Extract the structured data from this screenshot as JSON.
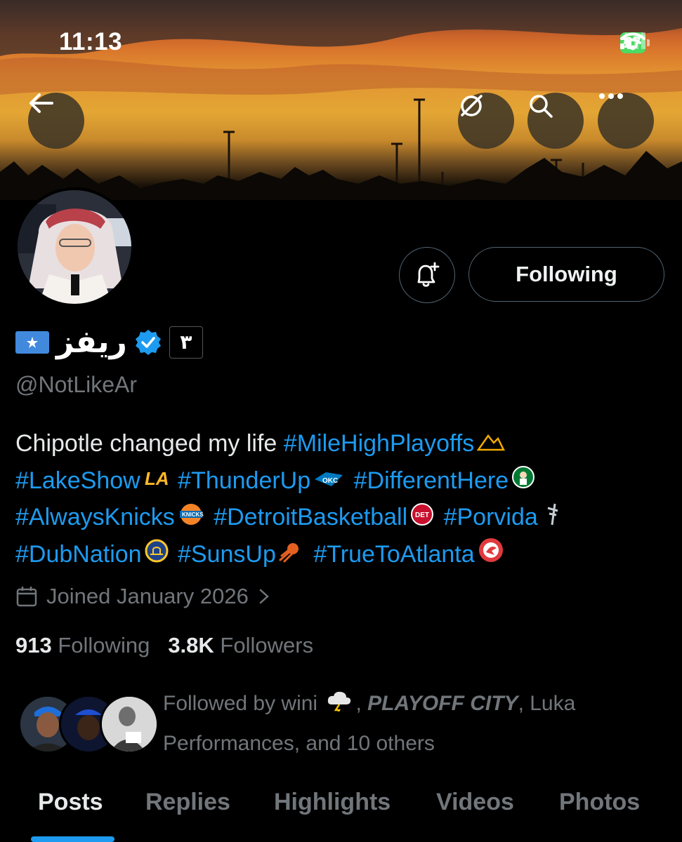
{
  "status_bar": {
    "time": "11:13",
    "battery": "27"
  },
  "header": {
    "back_icon": "arrow-left-icon",
    "grok_icon": "grok-icon",
    "search_icon": "search-icon",
    "more_icon": "more-icon"
  },
  "profile": {
    "display_name": "ريفز",
    "badge_text": "٣",
    "handle": "@NotLikeAr",
    "follow_button": "Following",
    "bio": {
      "text": "Chipotle changed my life",
      "tags": [
        "#MileHighPlayoffs",
        "#LakeShow",
        "#ThunderUp",
        "#DifferentHere",
        "#AlwaysKnicks",
        "#DetroitBasketball",
        "#Porvida",
        "#DubNation",
        "#SunsUp",
        "#TrueToAtlanta"
      ]
    },
    "joined": "Joined January 2026",
    "following_count": "913",
    "following_label": "Following",
    "followers_count": "3.8K",
    "followers_label": "Followers",
    "followed_by": {
      "prefix": "Followed by wini",
      "sep": ",",
      "bold": "PLAYOFF CITY",
      "rest": ", Luka Performances, and 10 others"
    }
  },
  "colors": {
    "accent": "#1d9bf0",
    "muted": "#71767b",
    "text": "#e7e9ea",
    "battery": "#4cd964"
  },
  "tabs": [
    "Posts",
    "Replies",
    "Highlights",
    "Videos",
    "Photos"
  ]
}
